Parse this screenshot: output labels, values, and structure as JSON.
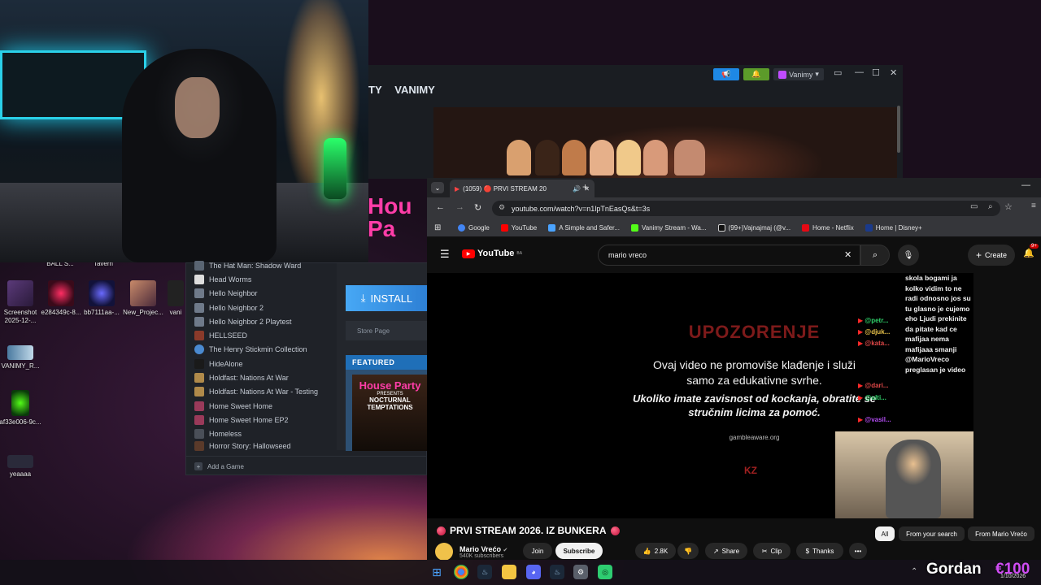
{
  "desktop_icons": [
    {
      "label": "BALL S..."
    },
    {
      "label": "Tavern"
    },
    {
      "label": "Screenshot 2025-12-..."
    },
    {
      "label": "e284349c-8..."
    },
    {
      "label": "bb7111aa-..."
    },
    {
      "label": "New_Projec..."
    },
    {
      "label": "vani"
    },
    {
      "label": "VANIMY_R..."
    },
    {
      "label": "af33e006-9c..."
    },
    {
      "label": "yeaaaa"
    }
  ],
  "webcam": {
    "logo_text": "Hou Pa"
  },
  "launcher": {
    "nav_items": [
      "TY",
      "VANIMY"
    ],
    "account_name": "Vanimy",
    "account_caret": "▾",
    "window_controls": [
      "▭",
      "—",
      "☐",
      "✕"
    ]
  },
  "library": {
    "games": [
      "The Hat Man: Shadow Ward",
      "Head Worms",
      "Hello Neighbor",
      "Hello Neighbor 2",
      "Hello Neighbor 2 Playtest",
      "HELLSEED",
      "The Henry Stickmin Collection",
      "HideAlone",
      "Holdfast: Nations At War",
      "Holdfast: Nations At War - Testing",
      "Home Sweet Home",
      "Home Sweet Home EP2",
      "Homeless",
      "Horror Story: Hallowseed"
    ],
    "install_label": "INSTALL",
    "store_page_label": "Store Page",
    "featured_label": "FEATURED",
    "featured_art_title": "House Party",
    "featured_art_sub": "PRESENTS",
    "featured_art_name": "NOCTURNAL TEMPTATIONS",
    "add_game_label": "Add a Game"
  },
  "browser": {
    "tab_title": "(1059) 🔴 PRVI STREAM 20",
    "tab_close": "✕",
    "new_tab": "+",
    "url": "youtube.com/watch?v=n1lpTnEasQs&t=3s",
    "bookmarks": [
      {
        "label": "Google",
        "color": "#4285f4"
      },
      {
        "label": "YouTube",
        "color": "#ff0000"
      },
      {
        "label": "A Simple and Safer...",
        "color": "#4aa3ff"
      },
      {
        "label": "Vanimy Stream - Wa...",
        "color": "#53fc18"
      },
      {
        "label": "(99+)Vajnajmaj (@v...",
        "color": "#111111"
      },
      {
        "label": "Home - Netflix",
        "color": "#e50914"
      },
      {
        "label": "Home | Disney+",
        "color": "#1a3a8c"
      }
    ]
  },
  "youtube": {
    "logo_text": "YouTube",
    "logo_country": "BA",
    "search_value": "mario vreco",
    "create_label": "Create",
    "notif_badge": "9+",
    "warning_title": "UPOZORENJE",
    "warning_line1": "Ovaj video ne promoviše klađenje i služi",
    "warning_line2": "samo za edukativne svrhe.",
    "warning_line3": "Ukoliko imate zavisnost od kockanja, obratite se",
    "warning_line4": "stručnim licima za pomoć.",
    "gamble_site": "gambleaware.org",
    "kz_logo": "KZ",
    "chat_names": [
      {
        "name": "@petr...",
        "color": "green"
      },
      {
        "name": "@djuk...",
        "color": "green"
      },
      {
        "name": "@kata...",
        "color": "red"
      },
      {
        "name": "@dari...",
        "color": "red"
      },
      {
        "name": "@ulti...",
        "color": "green"
      },
      {
        "name": "@vasil...",
        "color": "purple"
      }
    ],
    "chat_text": "skola bogami ja kolko vidim to ne radi odnosno jos su tu glasno je cujemo eho Ljudi prekinite da pitate kad ce mafijaa nema mafijaaa smanji @MarioVreco preglasan je video",
    "video_title": "PRVI STREAM 2026. IZ BUNKERA",
    "channel_name": "Mario Vrećo",
    "channel_subs": "540K subscribers",
    "join_label": "Join",
    "subscribe_label": "Subscribe",
    "like_count": "2.8K",
    "share_label": "Share",
    "clip_label": "Clip",
    "thanks_label": "Thanks",
    "more_label": "•••",
    "filter_chips": [
      "All",
      "From your search",
      "From Mario Vrećo"
    ]
  },
  "overlay": {
    "name": "Gordan",
    "currency": "€100",
    "date": "1/10/2026"
  }
}
